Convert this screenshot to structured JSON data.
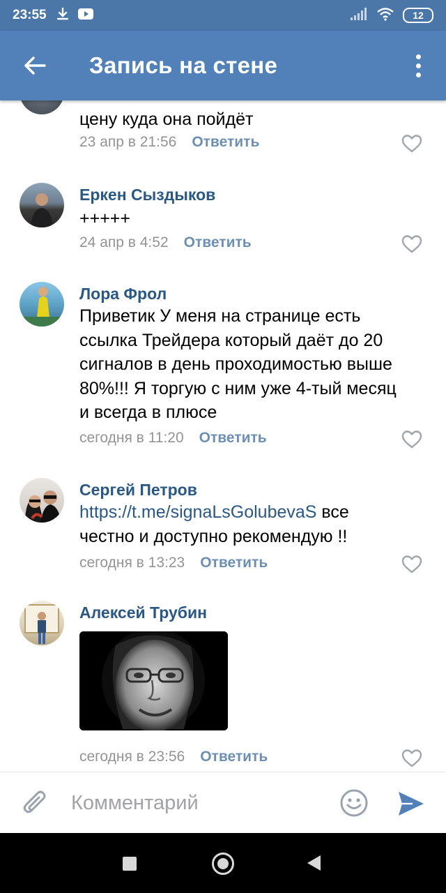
{
  "status_bar": {
    "time": "23:55",
    "battery": "12",
    "icons": [
      "download-icon",
      "youtube-icon",
      "signal-icon",
      "wifi-icon",
      "battery-icon"
    ]
  },
  "app_bar": {
    "title": "Запись на стене",
    "back_icon": "arrow-left-icon",
    "more_icon": "more-vertical-icon"
  },
  "comments": [
    {
      "author": "",
      "text_lines": [
        "цену куда она пойдёт"
      ],
      "date": "23 апр в 21:56",
      "reply": "Ответить"
    },
    {
      "author": "Еркен Сыздыков",
      "text_lines": [
        "+++++"
      ],
      "date": "24 апр в 4:52",
      "reply": "Ответить"
    },
    {
      "author": "Лора Фрол",
      "text_lines": [
        "Приветик У меня на странице есть",
        "ссылка Трейдера который даёт до 20",
        "сигналов в день проходимостью выше",
        "80%!!! Я торгую с ним уже 4-тый месяц",
        "и всегда в плюсе"
      ],
      "date": "сегодня в 11:20",
      "reply": "Ответить"
    },
    {
      "author": "Сергей Петров",
      "link": "https://t.me/signaLsGolubevaS",
      "text_after_link": " все",
      "text_lines": [
        "честно и доступно рекомендую !!"
      ],
      "date": "сегодня в 13:23",
      "reply": "Ответить"
    },
    {
      "author": "Алексей Трубин",
      "attachment": "photo-attachment",
      "date": "сегодня в 23:56",
      "reply": "Ответить"
    }
  ],
  "composer": {
    "placeholder": "Комментарий",
    "attach_icon": "paperclip-icon",
    "emoji_icon": "smiley-icon",
    "send_icon": "send-icon"
  },
  "nav_bar": {
    "icons": [
      "recents-icon",
      "home-icon",
      "back-icon"
    ]
  },
  "colors": {
    "status_bar": "#4a76a8",
    "app_bar": "#5181b8",
    "author": "#2a5885",
    "date": "#939393",
    "reply": "#6d8fb3",
    "accent": "#5181b8"
  }
}
